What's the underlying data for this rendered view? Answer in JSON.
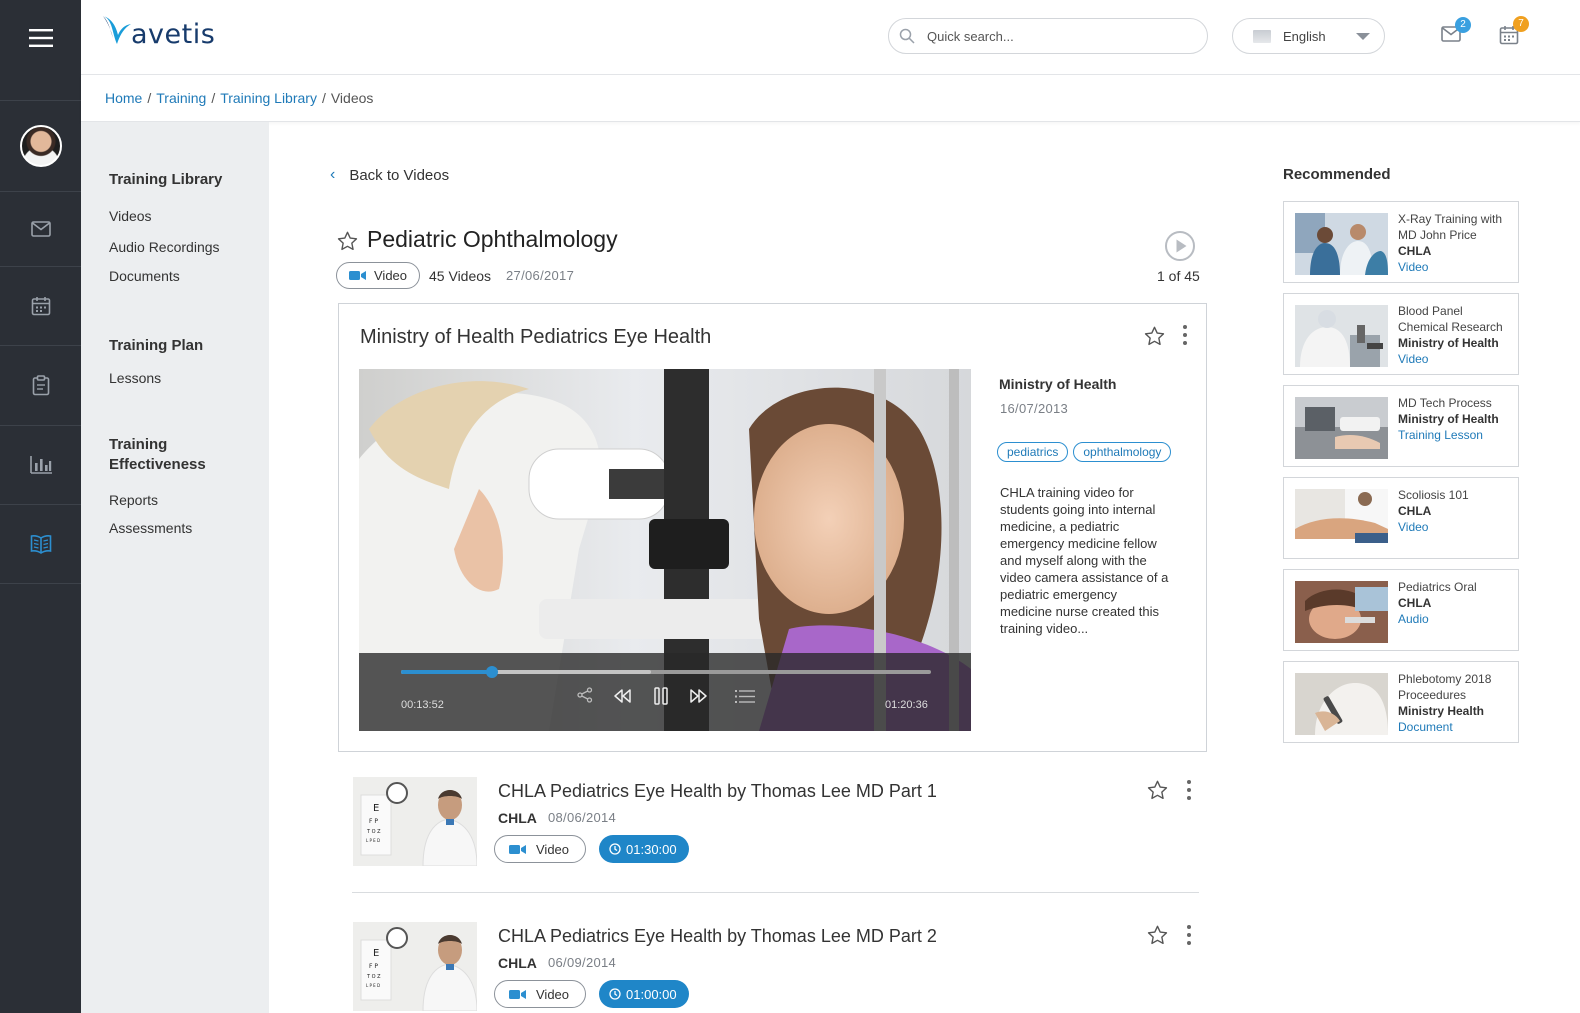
{
  "app": {
    "logo": "avetis"
  },
  "header": {
    "search_placeholder": "Quick search...",
    "language": "English",
    "mail_badge": "2",
    "calendar_badge": "7",
    "colors": {
      "accent": "#1f86c8",
      "mail_badge": "#3aa0e0",
      "calendar_badge": "#f0a020"
    }
  },
  "breadcrumb": {
    "home": "Home",
    "training": "Training",
    "library": "Training Library",
    "current": "Videos"
  },
  "sidebar": {
    "library_heading": "Training Library",
    "library_items": [
      "Videos",
      "Audio Recordings",
      "Documents"
    ],
    "plan_heading": "Training Plan",
    "plan_items": [
      "Lessons"
    ],
    "effectiveness_heading": "Training Effectiveness",
    "effectiveness_items": [
      "Reports",
      "Assessments"
    ]
  },
  "main": {
    "back_label": "Back to Videos",
    "title": "Pediatric Ophthalmology",
    "type_label": "Video",
    "video_count": "45 Videos",
    "date": "27/06/2017",
    "position": "1 of 45",
    "featured": {
      "title": "Ministry of Health Pediatrics Eye Health",
      "org": "Ministry of Health",
      "date": "16/07/2013",
      "tags": [
        "pediatrics",
        "ophthalmology"
      ],
      "description": "CHLA training video for students going into internal medicine, a pediatric emergency medicine fellow and myself along with the video camera assistance of a pediatric emergency medicine nurse created this training video...",
      "elapsed": "00:13:52",
      "duration": "01:20:36",
      "progress_fraction": 0.172
    },
    "items": [
      {
        "title": "CHLA Pediatrics Eye Health by Thomas Lee MD Part 1",
        "org": "CHLA",
        "date": "08/06/2014",
        "type": "Video",
        "duration": "01:30:00"
      },
      {
        "title": "CHLA Pediatrics Eye Health by Thomas Lee MD Part 2",
        "org": "CHLA",
        "date": "06/09/2014",
        "type": "Video",
        "duration": "01:00:00"
      }
    ]
  },
  "recommended": {
    "heading": "Recommended",
    "items": [
      {
        "title": "X-Ray Training with MD John Price",
        "org": "CHLA",
        "type": "Video"
      },
      {
        "title": "Blood Panel Chemical Research",
        "org": "Ministry of Health",
        "type": "Video"
      },
      {
        "title": "MD Tech Process",
        "org": "Ministry of Health",
        "type": "Training Lesson"
      },
      {
        "title": "Scoliosis 101",
        "org": "CHLA",
        "type": "Video"
      },
      {
        "title": "Pediatrics Oral",
        "org": "CHLA",
        "type": "Audio"
      },
      {
        "title": "Phlebotomy 2018 Proceedures",
        "org": "Ministry Health",
        "type": "Document"
      }
    ]
  }
}
